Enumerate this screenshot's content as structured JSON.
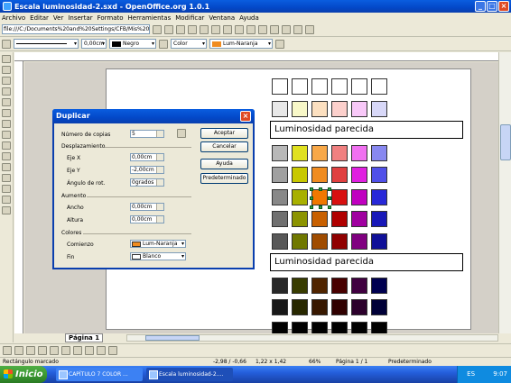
{
  "window": {
    "title": "Escala luminosidad-2.sxd - OpenOffice.org 1.0.1"
  },
  "menu": [
    "Archivo",
    "Editar",
    "Ver",
    "Insertar",
    "Formato",
    "Herramientas",
    "Modificar",
    "Ventana",
    "Ayuda"
  ],
  "toolbar": {
    "url": "file:///C:/Documents%20and%20Settings/CFB/Mis%20do",
    "line_color": "Negro",
    "area_type": "Color",
    "area_color": "Lum-Naranja"
  },
  "document": {
    "label_top": "Luminosidad parecida",
    "label_bottom": "Luminosidad parecida",
    "tab": "Página 1",
    "swatch_rows": [
      [
        "#ffffff",
        "#ffffff",
        "#ffffff",
        "#ffffff",
        "#ffffff",
        "#ffffff"
      ],
      [
        "#e8e8e8",
        "#f8f8c8",
        "#fce0c0",
        "#fcd0cc",
        "#f8c8f8",
        "#d8d8f8"
      ],
      [
        "#d0d0d0",
        "#f0f0a0",
        "#fcc890",
        "#f4a8a0",
        "#f4a0f4",
        "#b0b0f8"
      ],
      [
        "#b8b8b8",
        "#e0e020",
        "#f8a848",
        "#f08080",
        "#f070f0",
        "#8888f0"
      ],
      [
        "#a0a0a0",
        "#c8c800",
        "#f08c20",
        "#e04040",
        "#e020e0",
        "#5050e8"
      ],
      [
        "#888888",
        "#a8b000",
        "#f07800",
        "#d81010",
        "#c000c0",
        "#2828d8"
      ],
      [
        "#707070",
        "#8c9400",
        "#c86000",
        "#b00000",
        "#a000a0",
        "#1818b8"
      ],
      [
        "#585858",
        "#707800",
        "#a04c00",
        "#900000",
        "#800080",
        "#101098"
      ],
      [
        "#404040",
        "#545800",
        "#783800",
        "#700000",
        "#600060",
        "#080870"
      ],
      [
        "#282828",
        "#383c00",
        "#502400",
        "#480000",
        "#400040",
        "#000050"
      ],
      [
        "#181818",
        "#282800",
        "#381800",
        "#300000",
        "#2c002c",
        "#000038"
      ],
      [
        "#000000",
        "#000000",
        "#000000",
        "#000000",
        "#000000",
        "#000000"
      ]
    ],
    "selected_swatch": {
      "row": 5,
      "col": 2
    }
  },
  "dialog": {
    "title": "Duplicar",
    "copies_label": "Número de copias",
    "copies_value": "5",
    "group_displacement": "Desplazamiento",
    "x_label": "Eje X",
    "x_value": "0,00cm",
    "y_label": "Eje Y",
    "y_value": "-2,00cm",
    "angle_label": "Ángulo de rot.",
    "angle_value": "0grados",
    "group_increase": "Aumento",
    "width_label": "Ancho",
    "width_value": "0,00cm",
    "height_label": "Altura",
    "height_value": "0,00cm",
    "group_colors": "Colores",
    "start_label": "Comienzo",
    "start_value": "Lum-Naranja",
    "start_color": "#f08c20",
    "end_label": "Fin",
    "end_value": "Blanco",
    "end_color": "#ffffff",
    "btn_ok": "Aceptar",
    "btn_cancel": "Cancelar",
    "btn_help": "Ayuda",
    "btn_default": "Predeterminado"
  },
  "status": {
    "selection": "Rectángulo marcado",
    "position": "-2,98 / -0,66",
    "size": "1,22 x 1,42",
    "zoom": "66%",
    "page": "Página 1 / 1",
    "style": "Predeterminado"
  },
  "taskbar": {
    "start": "Inicio",
    "tasks": [
      "CAPÍTULO 7 COLOR ...",
      "Escala luminosidad-2...."
    ],
    "lang": "ES",
    "clock": "9:07"
  }
}
